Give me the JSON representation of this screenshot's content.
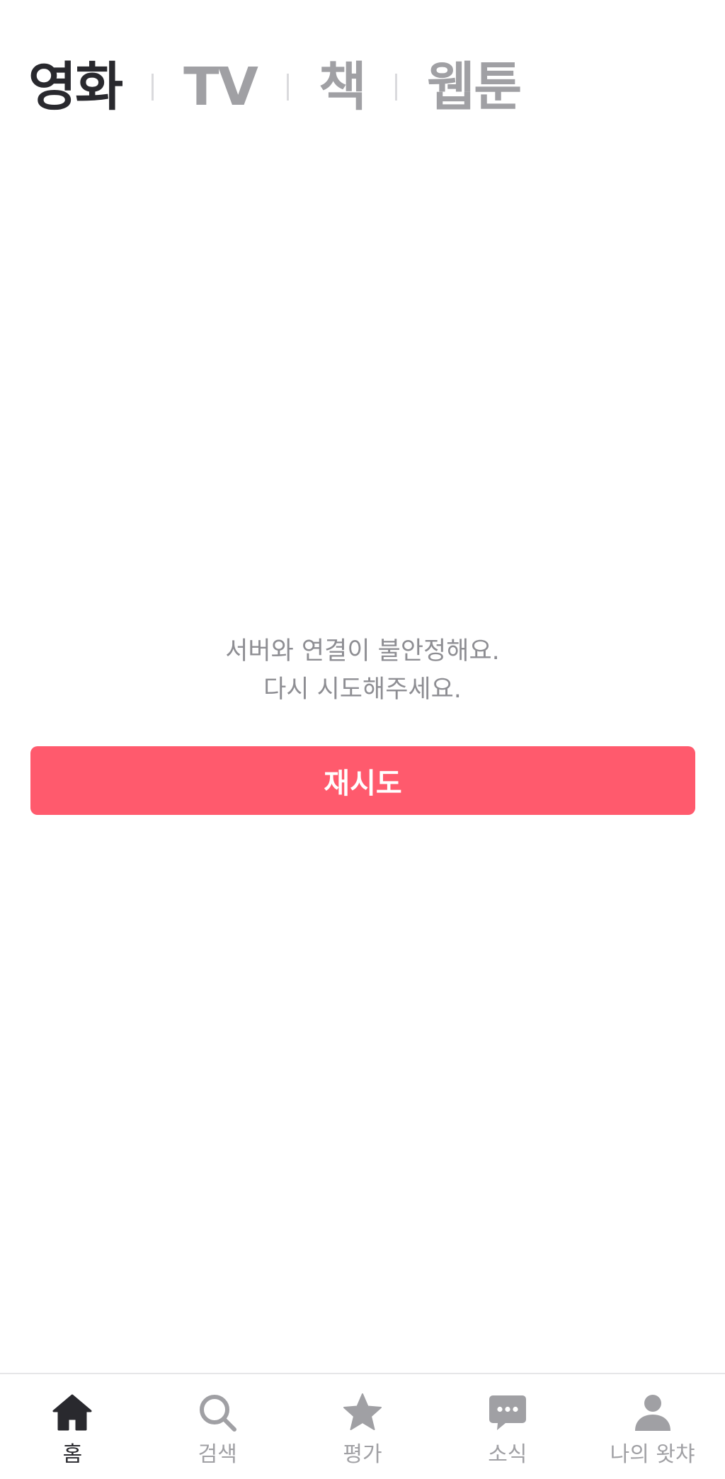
{
  "tabs": [
    {
      "label": "영화",
      "active": true
    },
    {
      "label": "TV",
      "active": false
    },
    {
      "label": "책",
      "active": false
    },
    {
      "label": "웹툰",
      "active": false
    }
  ],
  "error": {
    "line1": "서버와 연결이 불안정해요.",
    "line2": "다시 시도해주세요."
  },
  "retry_button": {
    "label": "재시도"
  },
  "bottom_nav": [
    {
      "label": "홈",
      "icon": "home-icon",
      "active": true
    },
    {
      "label": "검색",
      "icon": "search-icon",
      "active": false
    },
    {
      "label": "평가",
      "icon": "star-icon",
      "active": false
    },
    {
      "label": "소식",
      "icon": "chat-bubble-icon",
      "active": false
    },
    {
      "label": "나의 왓챠",
      "icon": "person-icon",
      "active": false
    }
  ],
  "colors": {
    "accent": "#ff5a6d",
    "active_text": "#29292e",
    "inactive_text": "#a0a0a4",
    "message_text": "#8e8e93"
  }
}
